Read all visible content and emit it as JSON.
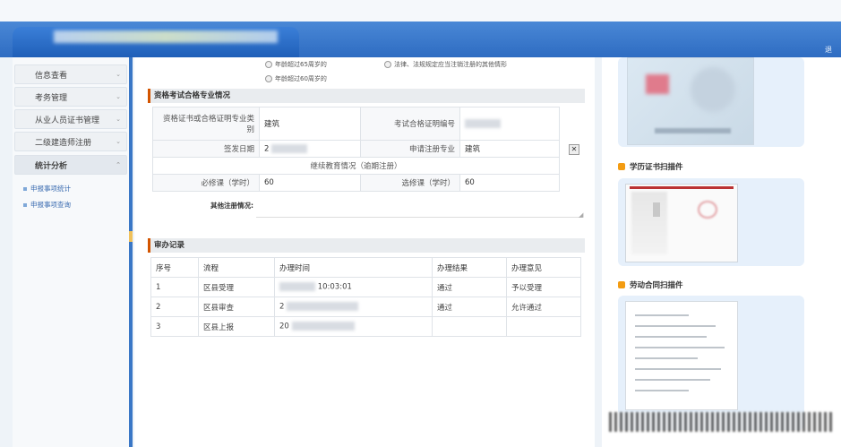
{
  "header": {
    "right_text": "退"
  },
  "sidebar": {
    "items": [
      {
        "label": "信息查看"
      },
      {
        "label": "考务管理"
      },
      {
        "label": "从业人员证书管理"
      },
      {
        "label": "二级建造师注册"
      },
      {
        "label": "统计分析"
      }
    ],
    "sub_items": [
      {
        "label": "申报事项统计"
      },
      {
        "label": "申报事项查询"
      }
    ]
  },
  "main": {
    "radios": {
      "r1": "年龄超过65周岁的",
      "r2": "法律、法规规定应当注销注册的其他情形",
      "r3": "年龄超过60周岁的"
    },
    "qualification_section": {
      "title": "资格考试合格专业情况",
      "cert_spec_label": "资格证书或合格证明专业类别",
      "cert_spec_value": "建筑",
      "exam_cert_no_label": "考试合格证明编号",
      "issue_date_label": "签发日期",
      "issue_date_value": "2",
      "apply_spec_label": "申请注册专业",
      "apply_spec_value": "建筑",
      "continuing_edu": "继续教育情况（逾期注册）",
      "required_label": "必修课（学时）",
      "required_value": "60",
      "elective_label": "选修课（学时）",
      "elective_value": "60",
      "other_label": "其他注册情况:",
      "delete_glyph": "✕"
    },
    "records_section": {
      "title": "审办记录",
      "columns": [
        "序号",
        "流程",
        "办理时间",
        "办理结果",
        "办理意见"
      ],
      "rows": [
        {
          "no": "1",
          "process": "区县受理",
          "time": "10:03:01",
          "result": "通过",
          "opinion": "予以受理"
        },
        {
          "no": "2",
          "process": "区县审查",
          "time": "2",
          "result": "通过",
          "opinion": "允许通过"
        },
        {
          "no": "3",
          "process": "区县上报",
          "time": "20",
          "result": "",
          "opinion": ""
        }
      ]
    }
  },
  "right_panel": {
    "card2_title": "学历证书扫描件",
    "card3_title": "劳动合同扫描件"
  }
}
